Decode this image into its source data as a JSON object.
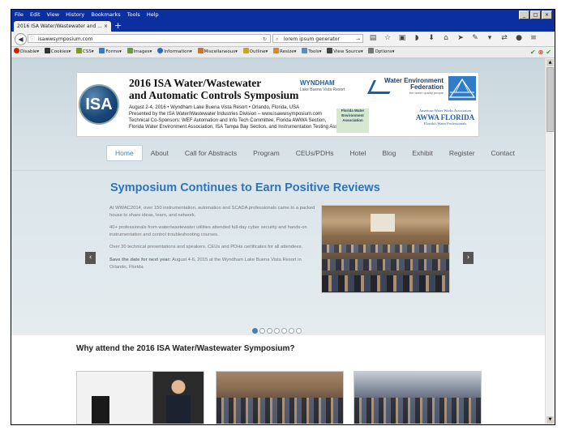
{
  "browser": {
    "menu": [
      "File",
      "Edit",
      "View",
      "History",
      "Bookmarks",
      "Tools",
      "Help"
    ],
    "window_buttons": [
      "_",
      "□",
      "×"
    ],
    "tab_title": "2016 ISA Water/Wastewater and ...",
    "tab_close": "×",
    "new_tab": "+",
    "url": "isawwsymposium.com",
    "search_placeholder": "lorem ipsum generator",
    "toolbar_icons": [
      "reading-list-icon",
      "bookmark-star-icon",
      "clipboard-icon",
      "pocket-icon",
      "download-icon",
      "home-icon",
      "send-icon",
      "pencil-icon",
      "menu-icon"
    ]
  },
  "devbar": {
    "items": [
      "Disable",
      "Cookies",
      "CSS",
      "Forms",
      "Images",
      "Information",
      "Miscellaneous",
      "Outline",
      "Resize",
      "Tools",
      "View Source",
      "Options"
    ],
    "icon_colors": [
      "#cc2200",
      "#333333",
      "#7a9a2a",
      "#3a7ac4",
      "#6a9a3a",
      "#2a6ac4",
      "#c47a2a",
      "#c4a42a",
      "#d4882a",
      "#5a8ac4",
      "#444444",
      "#777777"
    ]
  },
  "banner": {
    "logo": "ISA",
    "title_line1": "2016 ISA Water/Wastewater",
    "title_line2": "and Automatic Controls Symposium",
    "info_line1": "August 2-4, 2016 • Wyndham Lake Buena Vista Resort • Orlando, Florida, USA",
    "info_line2": "Presented by the ISA Water/Wastewater Industries Division – www.isawwsymposium.com",
    "info_line3": "Technical Co-Sponsors: WEF Automation and Info Tech Committee, Florida AWWA Section,",
    "info_line4": "Florida Water Environment Association, ISA Tampa Bay Section, and Instrumentation Testing Association",
    "sponsor_wyndham": "WYNDHAM",
    "sponsor_wyndham_sub": "Lake Buena Vista Resort",
    "sponsor_wef_line1": "Water Environment",
    "sponsor_wef_line2": "Federation",
    "sponsor_wef_tag": "the water quality people",
    "sponsor_fwea": "Florida Water Environment Association",
    "sponsor_awwa_line1": "American Water Works Association",
    "sponsor_awwa_big": "AWWA FLORIDA",
    "sponsor_awwa_line2": "Florida's Water Professionals"
  },
  "nav": [
    "Home",
    "About",
    "Call for Abstracts",
    "Program",
    "CEUs/PDHs",
    "Hotel",
    "Blog",
    "Exhibit",
    "Register",
    "Contact"
  ],
  "slide": {
    "title": "Symposium Continues to Earn Positive Reviews",
    "p1": "At WWAC2014, over 150 instrumentation, automation and SCADA professionals came to a packed house to share ideas, learn, and network.",
    "p2": "40+ professionals from water/wastewater utilities attended full-day cyber security and hands-on instrumentation and control troubleshooting courses.",
    "p3": "Over 30 technical presentations and speakers. CEUs and PDHs certificates for all attendees.",
    "p4_bold": "Save the date for next year:",
    "p4_rest": " August 4-6, 2015 at the Wyndham Lake Buena Vista Resort in Orlando, Florida",
    "prev": "‹",
    "next": "›",
    "dot_count": 7,
    "active_dot": 1
  },
  "why_title": "Why attend the 2016 ISA Water/Wastewater Symposium?",
  "colors": {
    "accent": "#2d74be",
    "menubar": "#0b2f9e",
    "hero_bg": "#dbe5ea"
  }
}
